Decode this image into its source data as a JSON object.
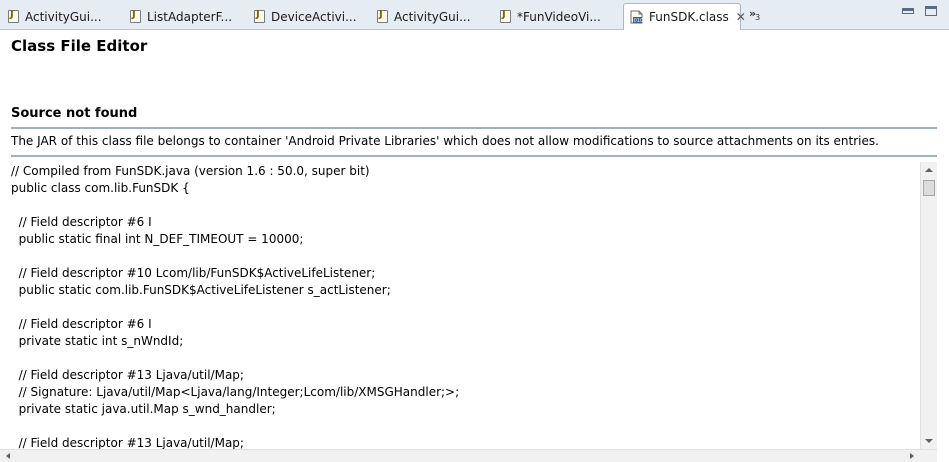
{
  "tabs": [
    {
      "label": "ActivityGui...",
      "icon": "java-file-icon"
    },
    {
      "label": "ListAdapterF...",
      "icon": "java-file-icon"
    },
    {
      "label": "DeviceActivi...",
      "icon": "java-file-icon"
    },
    {
      "label": "ActivityGui...",
      "icon": "java-file-icon"
    },
    {
      "label": "*FunVideoVi...",
      "icon": "java-file-icon"
    },
    {
      "label": "FunSDK.class",
      "icon": "class-file-icon",
      "active": true
    }
  ],
  "overflow": {
    "chevron": "»",
    "count": "3"
  },
  "editor": {
    "title": "Class File Editor",
    "section_title": "Source not found",
    "message": "The JAR of this class file belongs to container 'Android Private Libraries' which does not allow modifications to source attachments on its entries."
  },
  "code_lines": [
    "// Compiled from FunSDK.java (version 1.6 : 50.0, super bit)",
    "public class com.lib.FunSDK {",
    "",
    "  // Field descriptor #6 I",
    "  public static final int N_DEF_TIMEOUT = 10000;",
    "",
    "  // Field descriptor #10 Lcom/lib/FunSDK$ActiveLifeListener;",
    "  public static com.lib.FunSDK$ActiveLifeListener s_actListener;",
    "",
    "  // Field descriptor #6 I",
    "  private static int s_nWndId;",
    "",
    "  // Field descriptor #13 Ljava/util/Map;",
    "  // Signature: Ljava/util/Map<Ljava/lang/Integer;Lcom/lib/XMSGHandler;>;",
    "  private static java.util.Map s_wnd_handler;",
    "",
    "  // Field descriptor #13 Ljava/util/Map;"
  ],
  "colors": {
    "tabbar_bg": "#e6ecf4",
    "rule": "#9fb0c6"
  }
}
